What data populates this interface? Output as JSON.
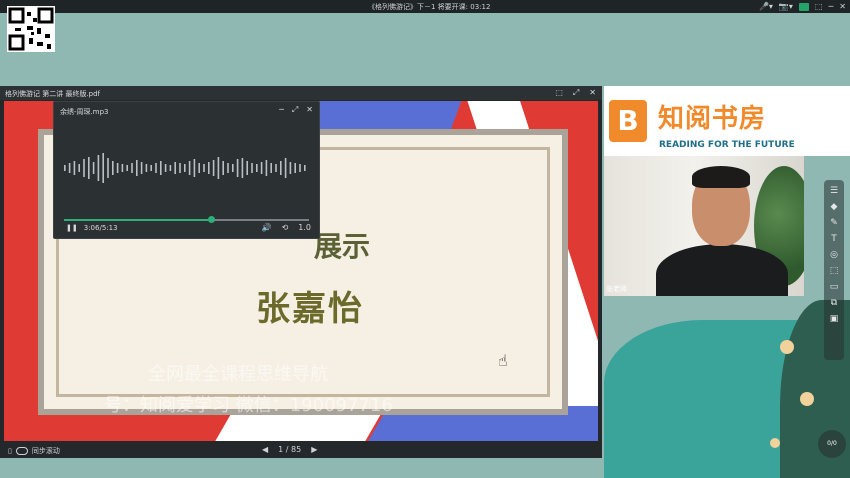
{
  "topbar": {
    "title": "《格列佛游记》下－1    将要开课: 03:12",
    "controls": [
      "🎤▾",
      "📷▾",
      "●",
      "⬚",
      "─",
      "✕"
    ]
  },
  "logo": {
    "mark": "B",
    "cn": "知阅书房",
    "en": "READING FOR THE FUTURE"
  },
  "cam": {
    "tag": "张老师"
  },
  "pdf": {
    "title": "格列佛游记 第二讲 最终版.pdf",
    "controls": [
      "⬚",
      "⤢",
      "✕"
    ],
    "slide": {
      "subtitle": "展示",
      "name": "张嘉怡",
      "watermark1": "全网最全课程思维导航",
      "watermark2": "号：知阅爱学习 微信：19009771​6"
    },
    "sync_label": "同步滚动",
    "page": {
      "current": "1",
      "sep": "/",
      "total": "85"
    }
  },
  "audio": {
    "title": "余绣-周琛.mp3",
    "controls": [
      "─",
      "⤢",
      "✕"
    ],
    "play_icon": "❚❚",
    "time_current": "3:06",
    "time_total": "5:13",
    "progress": 0.6,
    "right_controls": [
      "🔊",
      "⟲",
      "1.0"
    ]
  },
  "rtool": [
    "☰",
    "◆",
    "✎",
    "T",
    "◎",
    "⬚",
    "▭",
    "⧉",
    "▣"
  ],
  "rcircle": "0/0",
  "colors": {
    "accent": "#2bb07a",
    "brand": "#f08a2b",
    "slide_red": "#e03a35"
  }
}
